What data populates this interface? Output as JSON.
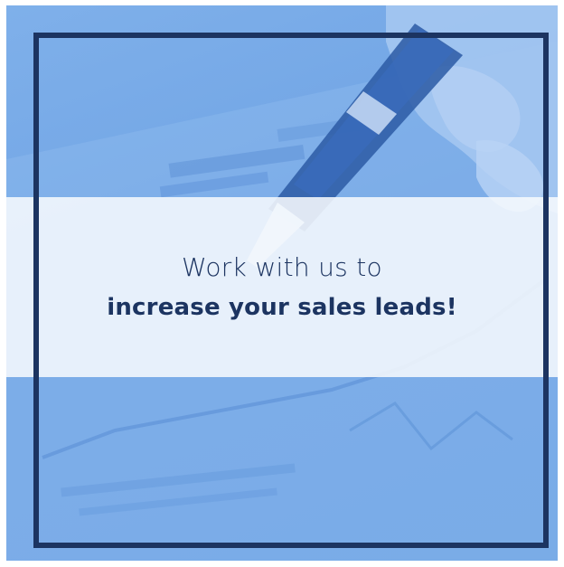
{
  "headline": {
    "line1": "Work with us to",
    "line2": "increase your sales leads!"
  },
  "colors": {
    "frame": "#1c3461",
    "text": "#1c3461",
    "background": "#6fa3e4",
    "band": "#f6f9fd"
  }
}
